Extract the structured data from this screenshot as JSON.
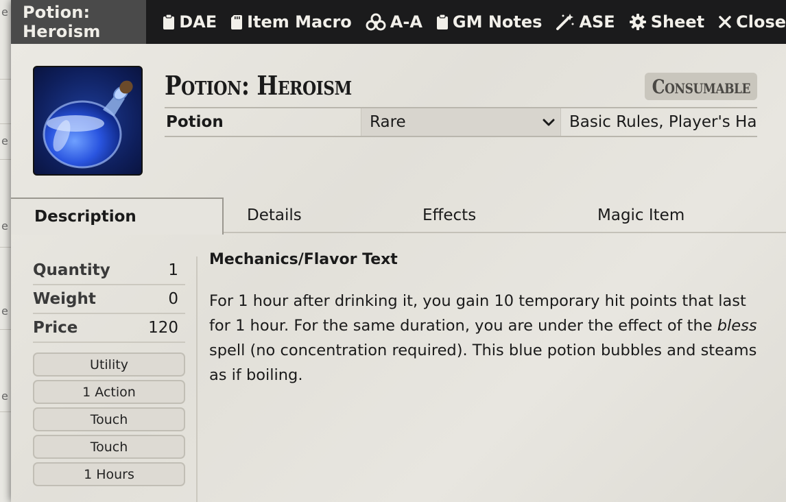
{
  "window": {
    "title": "Potion: Heroism"
  },
  "header_buttons": [
    {
      "label": "DAE",
      "icon": "clipboard-icon"
    },
    {
      "label": "Item Macro",
      "icon": "sd-card-icon"
    },
    {
      "label": "A-A",
      "icon": "biohazard-icon"
    },
    {
      "label": "GM Notes",
      "icon": "clipboard-icon"
    },
    {
      "label": "ASE",
      "icon": "magic-wand-icon"
    },
    {
      "label": "Sheet",
      "icon": "gear-icon"
    },
    {
      "label": "Close",
      "icon": "close-icon"
    }
  ],
  "item": {
    "name": "Potion: Heroism",
    "type_badge": "Consumable",
    "subtype": "Potion",
    "rarity": "Rare",
    "source": "Basic Rules, Player's Ha",
    "image_icon": "potion-flask-icon"
  },
  "tabs": [
    {
      "label": "Description",
      "active": true
    },
    {
      "label": "Details",
      "active": false
    },
    {
      "label": "Effects",
      "active": false
    },
    {
      "label": "Magic Item",
      "active": false
    }
  ],
  "properties": [
    {
      "label": "Quantity",
      "value": "1"
    },
    {
      "label": "Weight",
      "value": "0"
    },
    {
      "label": "Price",
      "value": "120"
    }
  ],
  "pills": [
    "Utility",
    "1 Action",
    "Touch",
    "Touch",
    "1 Hours"
  ],
  "description": {
    "heading": "Mechanics/Flavor Text",
    "text_before": "For 1 hour after drinking it, you gain 10 temporary hit points that last for 1 hour. For the same duration, you are under the effect of the ",
    "text_emphasis": "bless",
    "text_after": " spell (no concentration required). This blue potion bubbles and steams as if boiling."
  },
  "background": {
    "letters": [
      "e",
      "e",
      "e",
      "e",
      "e"
    ]
  },
  "colors": {
    "titlebar": "#1b1b1c",
    "title_box": "#4a4a4a",
    "parchment": "#e6e4de"
  }
}
